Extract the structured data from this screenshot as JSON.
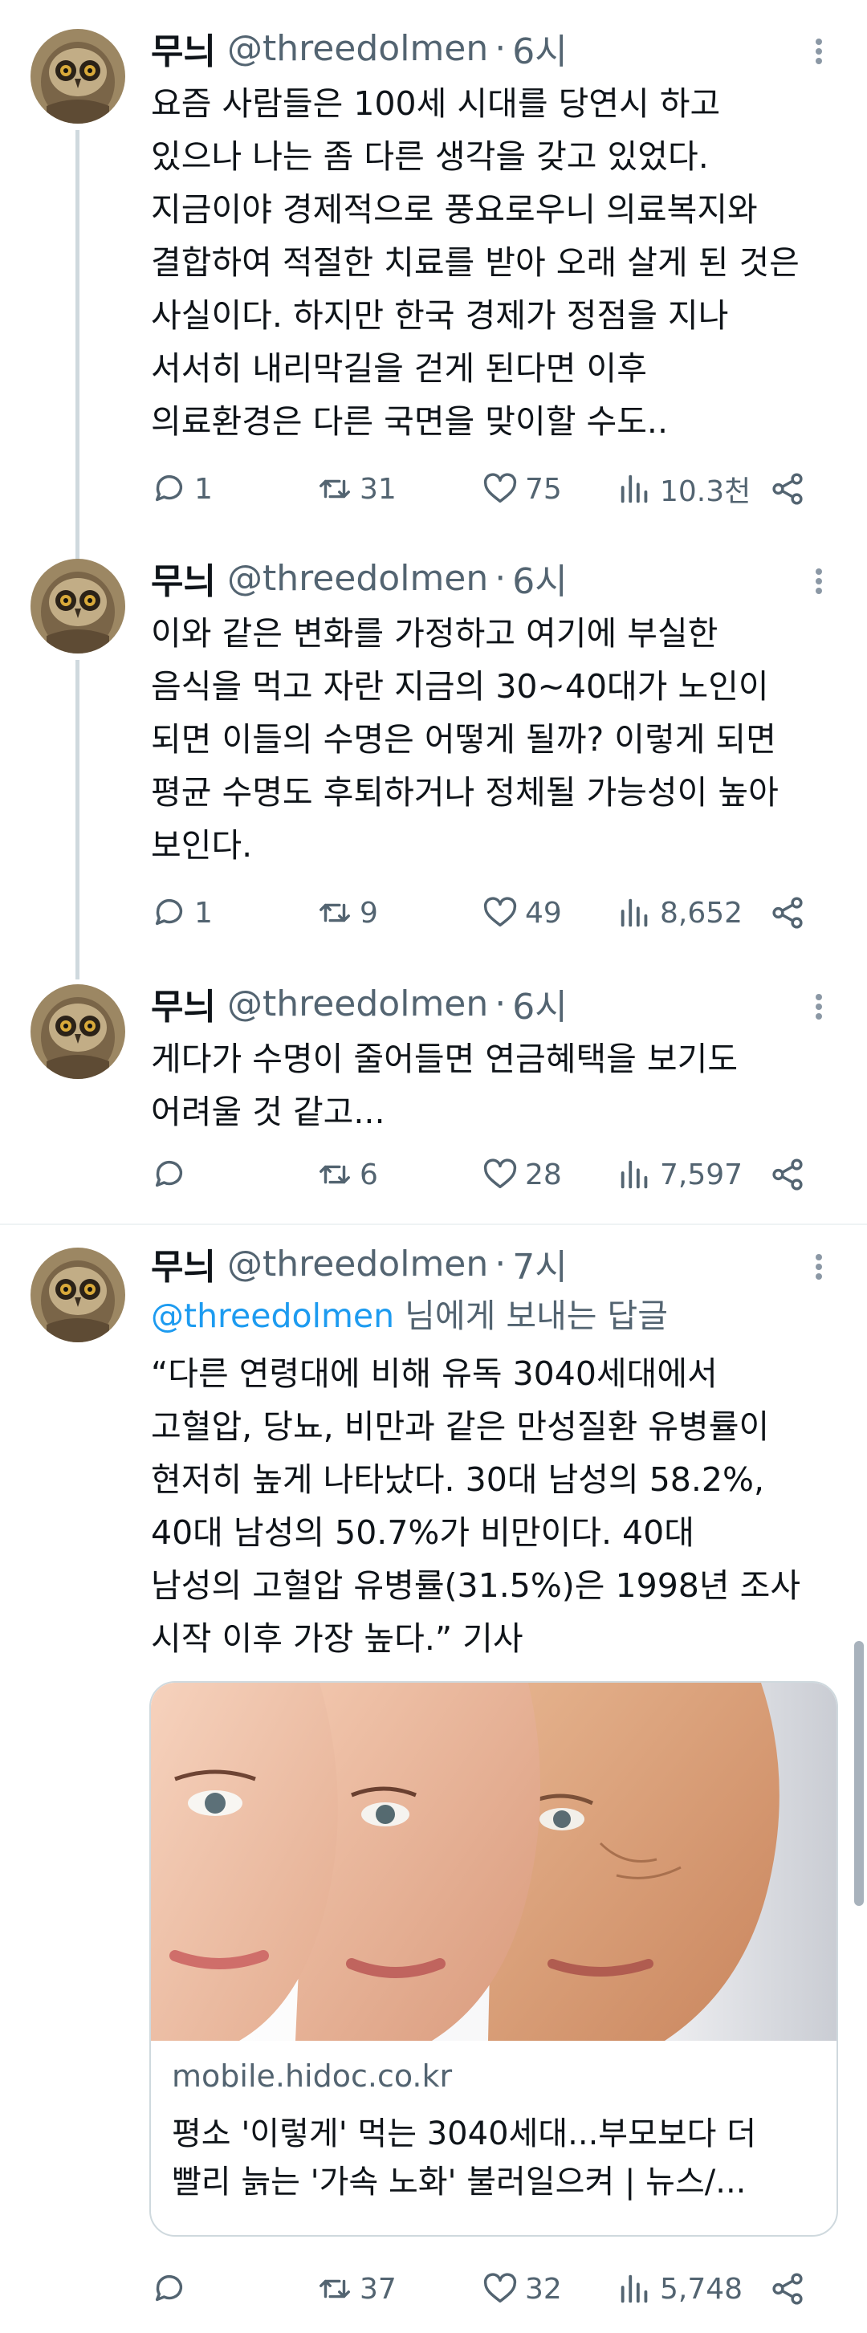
{
  "tweets": [
    {
      "name": "무늬",
      "handle": "@threedolmen",
      "sep": "·",
      "time": "6시",
      "lines": [
        "요즘 사람들은 100세 시대를 당연시 하고",
        "있으나 나는 좀 다른 생각을 갖고 있었다.",
        "지금이야 경제적으로 풍요로우니 의료복지와",
        "결합하여 적절한 치료를 받아 오래 살게 된 것은",
        "사실이다. 하지만 한국 경제가 정점을 지나",
        "서서히 내리막길을 걷게 된다면 이후",
        "의료환경은 다른 국면을 맞이할 수도.."
      ],
      "replies": "1",
      "retweets": "31",
      "likes": "75",
      "views": "10.3천"
    },
    {
      "name": "무늬",
      "handle": "@threedolmen",
      "sep": "·",
      "time": "6시",
      "lines": [
        "이와 같은 변화를 가정하고 여기에 부실한",
        "음식을 먹고 자란 지금의 30~40대가 노인이",
        "되면 이들의 수명은 어떻게 될까? 이렇게 되면",
        "평균 수명도 후퇴하거나 정체될 가능성이  높아",
        "보인다."
      ],
      "replies": "1",
      "retweets": "9",
      "likes": "49",
      "views": "8,652"
    },
    {
      "name": "무늬",
      "handle": "@threedolmen",
      "sep": "·",
      "time": "6시",
      "lines": [
        "게다가 수명이 줄어들면 연금혜택을 보기도",
        "어려울 것 같고..."
      ],
      "replies": "",
      "retweets": "6",
      "likes": "28",
      "views": "7,597"
    },
    {
      "name": "무늬",
      "handle": "@threedolmen",
      "sep": "·",
      "time": "7시",
      "reply_to_handle": "@threedolmen",
      "reply_to_suffix": " 님에게 보내는 답글",
      "lines": [
        "“다른 연령대에 비해 유독 3040세대에서",
        "고혈압, 당뇨, 비만과 같은 만성질환 유병률이",
        "현저히 높게 나타났다. 30대 남성의 58.2%,",
        "40대 남성의 50.7%가 비만이다. 40대",
        "남성의 고혈압 유병률(31.5%)은 1998년 조사",
        "시작 이후 가장 높다.” 기사"
      ],
      "card": {
        "domain": "mobile.hidoc.co.kr",
        "title_line1": "평소 '이렇게' 먹는 3040세대...부모보다 더",
        "title_line2": "빨리 늙는 '가속 노화' 불러일으켜 | 뉴스/..."
      },
      "replies": "",
      "retweets": "37",
      "likes": "32",
      "views": "5,748"
    }
  ],
  "colors": {
    "text": "#0f1419",
    "secondary": "#536471",
    "link": "#1d9bf0",
    "border": "#cfd9de"
  }
}
